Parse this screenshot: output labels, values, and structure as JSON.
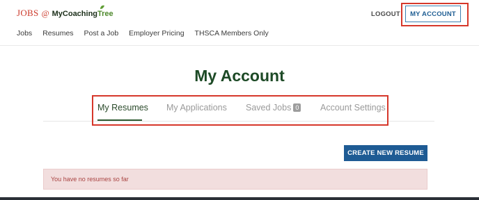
{
  "header": {
    "logo": {
      "jobs": "JOBS",
      "at": "@",
      "brand": "MyCoaching",
      "tree": "Tree"
    },
    "nav": [
      "Jobs",
      "Resumes",
      "Post a Job",
      "Employer Pricing",
      "THSCA Members Only"
    ],
    "logout_label": "LOGOUT",
    "account_label": "MY ACCOUNT"
  },
  "main": {
    "title": "My Account",
    "tabs": [
      {
        "label": "My Resumes",
        "active": true
      },
      {
        "label": "My Applications",
        "active": false
      },
      {
        "label": "Saved Jobs",
        "badge": "0",
        "active": false
      },
      {
        "label": "Account Settings",
        "active": false
      }
    ],
    "create_button": "CREATE NEW RESUME",
    "empty_message": "You have no resumes so far"
  },
  "colors": {
    "accent_blue": "#1e5b94",
    "title_green": "#1d4a26",
    "highlight_red": "#d6372a",
    "alert_bg": "#f2dede",
    "alert_text": "#a94442"
  }
}
